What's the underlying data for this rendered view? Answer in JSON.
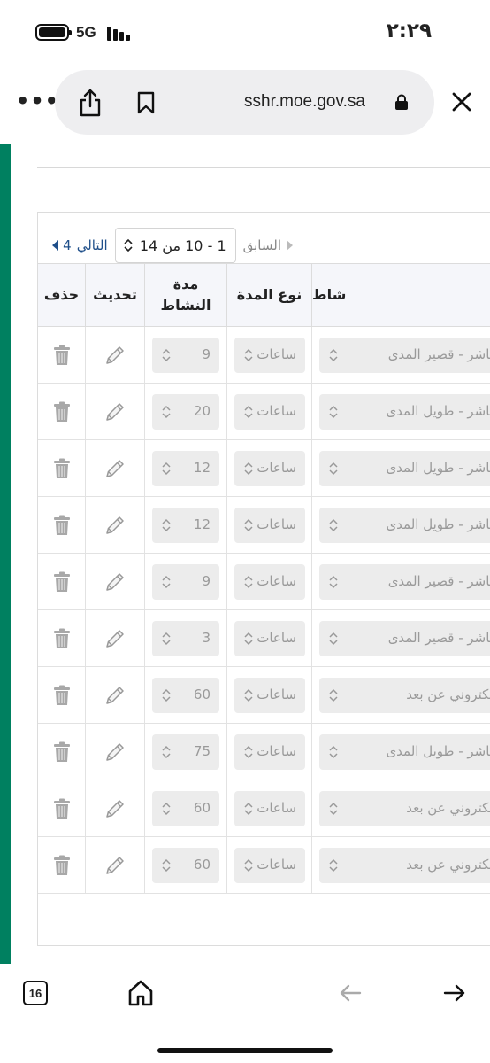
{
  "status_bar": {
    "network": "5G",
    "time": "٢:٢٩"
  },
  "browser": {
    "url": "sshr.moe.gov.sa",
    "tabs_count": "16"
  },
  "pager": {
    "prev_label": "السابق",
    "next_label": "التالي",
    "next_page": "4",
    "range": "1 - 10 من 14"
  },
  "table": {
    "columns": {
      "activity": "شاط",
      "duration_type": "نوع المدة",
      "duration_line1": "مدة",
      "duration_line2": "النشاط",
      "update": "تحديث",
      "delete": "حذف"
    },
    "rows": [
      {
        "activity": "باشر - قصير المدى",
        "duration_type": "ساعات",
        "duration": "9"
      },
      {
        "activity": "باشر - طويل المدى",
        "duration_type": "ساعات",
        "duration": "20"
      },
      {
        "activity": "باشر - طويل المدى",
        "duration_type": "ساعات",
        "duration": "12"
      },
      {
        "activity": "باشر - طويل المدى",
        "duration_type": "ساعات",
        "duration": "12"
      },
      {
        "activity": "باشر - قصير المدى",
        "duration_type": "ساعات",
        "duration": "9"
      },
      {
        "activity": "باشر - قصير المدى",
        "duration_type": "ساعات",
        "duration": "3"
      },
      {
        "activity": "لكتروني عن بعد",
        "duration_type": "ساعات",
        "duration": "60"
      },
      {
        "activity": "باشر - طويل المدى",
        "duration_type": "ساعات",
        "duration": "75"
      },
      {
        "activity": "لكتروني عن بعد",
        "duration_type": "ساعات",
        "duration": "60"
      },
      {
        "activity": "لكتروني عن بعد",
        "duration_type": "ساعات",
        "duration": "60"
      }
    ]
  },
  "colors": {
    "accent_green": "#008060",
    "link_blue": "#1f4f8a",
    "header_bg": "#f5f6fa"
  }
}
